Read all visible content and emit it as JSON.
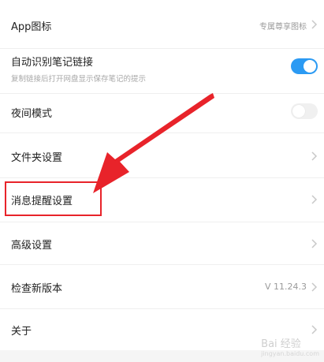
{
  "settings": {
    "app_icon": {
      "label": "App图标",
      "value": "专属尊享图标"
    },
    "auto_link": {
      "label": "自动识别笔记链接",
      "subtitle": "复制链接后打开网盘显示保存笔记的提示",
      "enabled": true
    },
    "night_mode": {
      "label": "夜间模式",
      "enabled": false
    },
    "folder": {
      "label": "文件夹设置"
    },
    "notify": {
      "label": "消息提醒设置"
    },
    "advanced": {
      "label": "高级设置"
    },
    "update": {
      "label": "检查新版本",
      "value": "V 11.24.3"
    },
    "about": {
      "label": "关于"
    }
  },
  "watermark": {
    "text": "Bai 经验",
    "sub": "jingyan.baidu.com"
  },
  "colors": {
    "toggle_on": "#2b9af3",
    "annotation": "#e8232a"
  }
}
